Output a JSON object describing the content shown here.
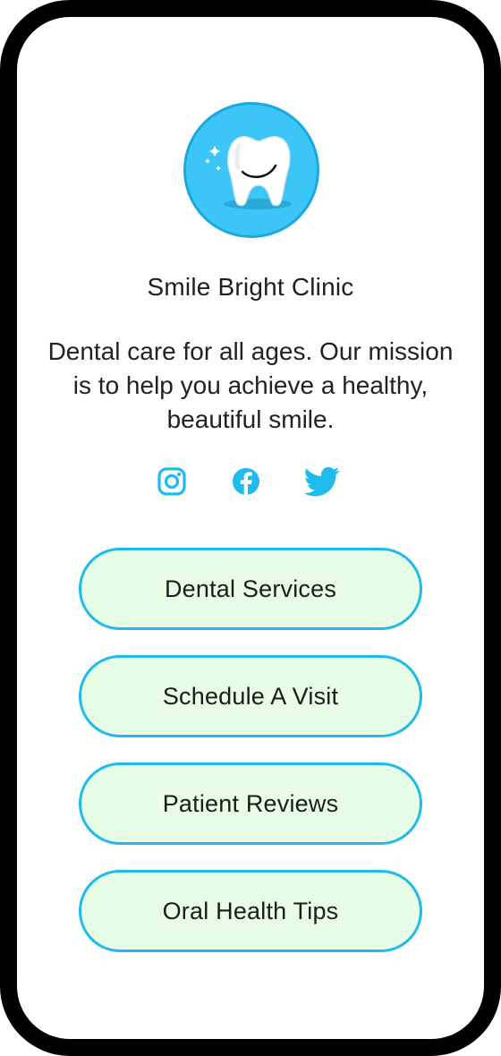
{
  "profile": {
    "avatar_icon": "tooth-icon",
    "name": "Smile Bright Clinic",
    "bio": "Dental care for all ages. Our mission is to help you achieve a healthy, beautiful smile."
  },
  "social": [
    {
      "icon": "instagram-icon"
    },
    {
      "icon": "facebook-icon"
    },
    {
      "icon": "twitter-icon"
    }
  ],
  "links": [
    {
      "label": "Dental Services"
    },
    {
      "label": "Schedule A Visit"
    },
    {
      "label": "Patient Reviews"
    },
    {
      "label": "Oral Health Tips"
    }
  ],
  "colors": {
    "accent": "#1ebbec",
    "button_fill": "#e8fde6",
    "avatar_bg": "#3cc6f8",
    "frame": "#000000"
  }
}
